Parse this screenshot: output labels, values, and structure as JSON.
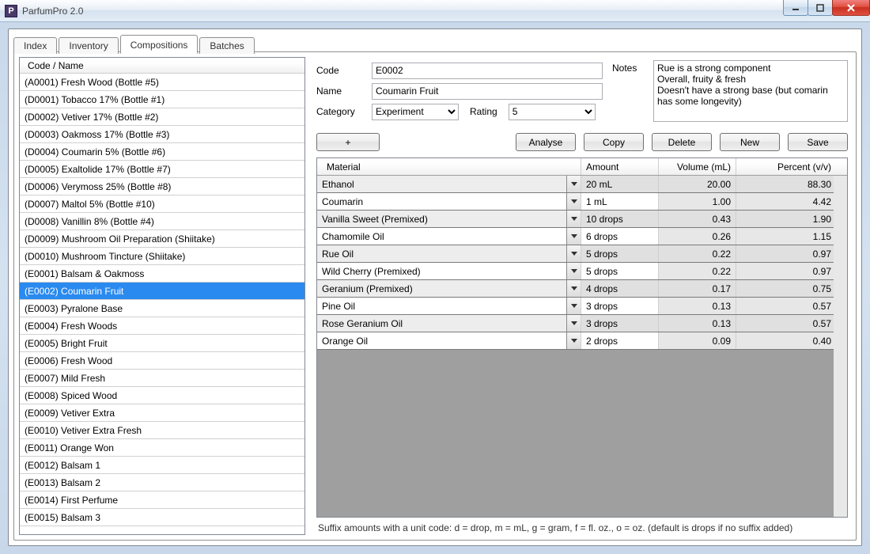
{
  "window": {
    "title": "ParfumPro 2.0"
  },
  "tabs": [
    "Index",
    "Inventory",
    "Compositions",
    "Batches"
  ],
  "active_tab": 2,
  "list": {
    "header": "Code / Name",
    "selected_index": 12,
    "items": [
      "(A0001) Fresh Wood (Bottle #5)",
      "(D0001) Tobacco 17% (Bottle #1)",
      "(D0002) Vetiver 17% (Bottle #2)",
      "(D0003) Oakmoss 17% (Bottle #3)",
      "(D0004) Coumarin 5% (Bottle #6)",
      "(D0005) Exaltolide 17% (Bottle #7)",
      "(D0006) Verymoss 25% (Bottle #8)",
      "(D0007) Maltol 5% (Bottle #10)",
      "(D0008) Vanillin 8% (Bottle #4)",
      "(D0009) Mushroom Oil Preparation (Shiitake)",
      "(D0010) Mushroom Tincture (Shiitake)",
      "(E0001) Balsam & Oakmoss",
      "(E0002) Coumarin Fruit",
      "(E0003) Pyralone Base",
      "(E0004) Fresh Woods",
      "(E0005) Bright Fruit",
      "(E0006) Fresh Wood",
      "(E0007) Mild Fresh",
      "(E0008) Spiced Wood",
      "(E0009) Vetiver Extra",
      "(E0010) Vetiver Extra Fresh",
      "(E0011) Orange Won",
      "(E0012) Balsam 1",
      "(E0013) Balsam 2",
      "(E0014) First Perfume",
      "(E0015) Balsam 3"
    ]
  },
  "form": {
    "code_label": "Code",
    "code_value": "E0002",
    "name_label": "Name",
    "name_value": "Coumarin Fruit",
    "category_label": "Category",
    "category_value": "Experiment",
    "rating_label": "Rating",
    "rating_value": "5",
    "notes_label": "Notes",
    "notes_value": "Rue is a strong component\nOverall, fruity & fresh\nDoesn't have a strong base (but comarin has some longevity)"
  },
  "buttons": {
    "add": "+",
    "analyse": "Analyse",
    "copy": "Copy",
    "delete": "Delete",
    "new": "New",
    "save": "Save"
  },
  "grid": {
    "headers": {
      "material": "Material",
      "amount": "Amount",
      "volume": "Volume (mL)",
      "percent": "Percent (v/v)"
    },
    "rows": [
      {
        "material": "Ethanol",
        "amount": "20 mL",
        "volume": "20.00",
        "percent": "88.30"
      },
      {
        "material": "Coumarin",
        "amount": "1 mL",
        "volume": "1.00",
        "percent": "4.42"
      },
      {
        "material": "Vanilla Sweet (Premixed)",
        "amount": "10 drops",
        "volume": "0.43",
        "percent": "1.90"
      },
      {
        "material": "Chamomile Oil",
        "amount": "6 drops",
        "volume": "0.26",
        "percent": "1.15"
      },
      {
        "material": "Rue Oil",
        "amount": "5 drops",
        "volume": "0.22",
        "percent": "0.97"
      },
      {
        "material": "Wild Cherry (Premixed)",
        "amount": "5 drops",
        "volume": "0.22",
        "percent": "0.97"
      },
      {
        "material": "Geranium (Premixed)",
        "amount": "4 drops",
        "volume": "0.17",
        "percent": "0.75"
      },
      {
        "material": "Pine Oil",
        "amount": "3 drops",
        "volume": "0.13",
        "percent": "0.57"
      },
      {
        "material": "Rose Geranium Oil",
        "amount": "3 drops",
        "volume": "0.13",
        "percent": "0.57"
      },
      {
        "material": "Orange Oil",
        "amount": "2 drops",
        "volume": "0.09",
        "percent": "0.40"
      }
    ]
  },
  "hint": "Suffix amounts with a unit code: d = drop, m = mL, g = gram, f = fl. oz., o = oz. (default is drops if no suffix added)"
}
